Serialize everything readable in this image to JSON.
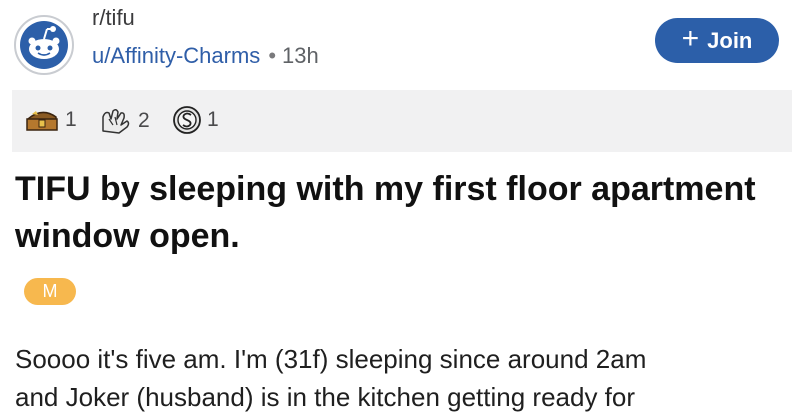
{
  "post": {
    "subreddit": "r/tifu",
    "author": "u/Affinity-Charms",
    "separator": "•",
    "age": "13h",
    "join_icon": "+",
    "join_label": "Join",
    "awards": [
      {
        "icon": "treasure-chest-award-icon",
        "count": "1"
      },
      {
        "icon": "hands-award-icon",
        "count": "2"
      },
      {
        "icon": "silver-coin-award-icon",
        "count": "1"
      }
    ],
    "title": "TIFU by sleeping with my first floor apartment window open.",
    "flair": "M",
    "body_lines": [
      "Soooo it's five am. I'm (31f) sleeping since around 2am",
      "and Joker (husband) is in the kitchen getting ready for"
    ]
  },
  "colors": {
    "accent": "#2c5fa9",
    "flair": "#f7b84e",
    "award_bar": "#f1f1f2"
  }
}
